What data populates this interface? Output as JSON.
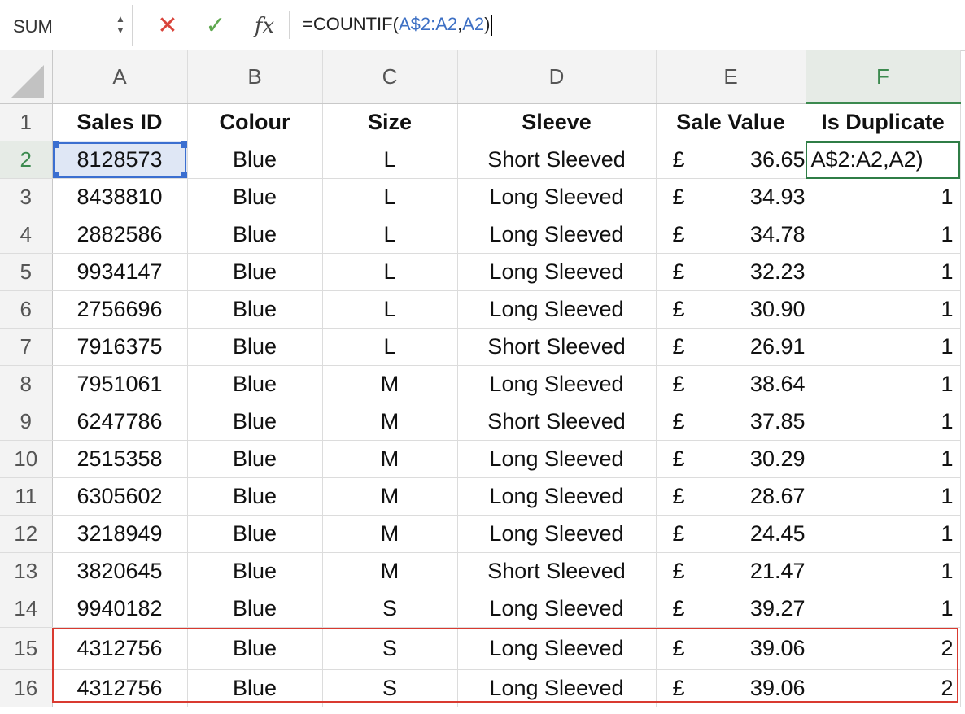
{
  "formula_bar": {
    "name_box": "SUM",
    "cancel_icon": "x-icon",
    "enter_icon": "check-icon",
    "fx_label": "fx",
    "formula_prefix": "=COUNTIF(",
    "formula_ref1": "A$2:A2",
    "formula_comma": ",",
    "formula_ref2": "A2",
    "formula_suffix": ")"
  },
  "columns": [
    "A",
    "B",
    "C",
    "D",
    "E",
    "F"
  ],
  "headers": [
    "Sales ID",
    "Colour",
    "Size",
    "Sleeve",
    "Sale Value",
    "Is Duplicate"
  ],
  "rows": [
    {
      "n": "1"
    },
    {
      "n": "2",
      "id": "8128573",
      "colour": "Blue",
      "size": "L",
      "sleeve": "Short Sleeved",
      "cur": "£",
      "value": "36.65",
      "dup": "A$2:A2,A2)"
    },
    {
      "n": "3",
      "id": "8438810",
      "colour": "Blue",
      "size": "L",
      "sleeve": "Long Sleeved",
      "cur": "£",
      "value": "34.93",
      "dup": "1"
    },
    {
      "n": "4",
      "id": "2882586",
      "colour": "Blue",
      "size": "L",
      "sleeve": "Long Sleeved",
      "cur": "£",
      "value": "34.78",
      "dup": "1"
    },
    {
      "n": "5",
      "id": "9934147",
      "colour": "Blue",
      "size": "L",
      "sleeve": "Long Sleeved",
      "cur": "£",
      "value": "32.23",
      "dup": "1"
    },
    {
      "n": "6",
      "id": "2756696",
      "colour": "Blue",
      "size": "L",
      "sleeve": "Long Sleeved",
      "cur": "£",
      "value": "30.90",
      "dup": "1"
    },
    {
      "n": "7",
      "id": "7916375",
      "colour": "Blue",
      "size": "L",
      "sleeve": "Short Sleeved",
      "cur": "£",
      "value": "26.91",
      "dup": "1"
    },
    {
      "n": "8",
      "id": "7951061",
      "colour": "Blue",
      "size": "M",
      "sleeve": "Long Sleeved",
      "cur": "£",
      "value": "38.64",
      "dup": "1"
    },
    {
      "n": "9",
      "id": "6247786",
      "colour": "Blue",
      "size": "M",
      "sleeve": "Short Sleeved",
      "cur": "£",
      "value": "37.85",
      "dup": "1"
    },
    {
      "n": "10",
      "id": "2515358",
      "colour": "Blue",
      "size": "M",
      "sleeve": "Long Sleeved",
      "cur": "£",
      "value": "30.29",
      "dup": "1"
    },
    {
      "n": "11",
      "id": "6305602",
      "colour": "Blue",
      "size": "M",
      "sleeve": "Long Sleeved",
      "cur": "£",
      "value": "28.67",
      "dup": "1"
    },
    {
      "n": "12",
      "id": "3218949",
      "colour": "Blue",
      "size": "M",
      "sleeve": "Long Sleeved",
      "cur": "£",
      "value": "24.45",
      "dup": "1"
    },
    {
      "n": "13",
      "id": "3820645",
      "colour": "Blue",
      "size": "M",
      "sleeve": "Short Sleeved",
      "cur": "£",
      "value": "21.47",
      "dup": "1"
    },
    {
      "n": "14",
      "id": "9940182",
      "colour": "Blue",
      "size": "S",
      "sleeve": "Long Sleeved",
      "cur": "£",
      "value": "39.27",
      "dup": "1"
    },
    {
      "n": "15",
      "id": "4312756",
      "colour": "Blue",
      "size": "S",
      "sleeve": "Long Sleeved",
      "cur": "£",
      "value": "39.06",
      "dup": "2"
    },
    {
      "n": "16",
      "id": "4312756",
      "colour": "Blue",
      "size": "S",
      "sleeve": "Long Sleeved",
      "cur": "£",
      "value": "39.06",
      "dup": "2"
    }
  ],
  "colors": {
    "selection": "#3b6fd0",
    "active_cell": "#2f7d46",
    "highlight_box": "#d93a30"
  }
}
